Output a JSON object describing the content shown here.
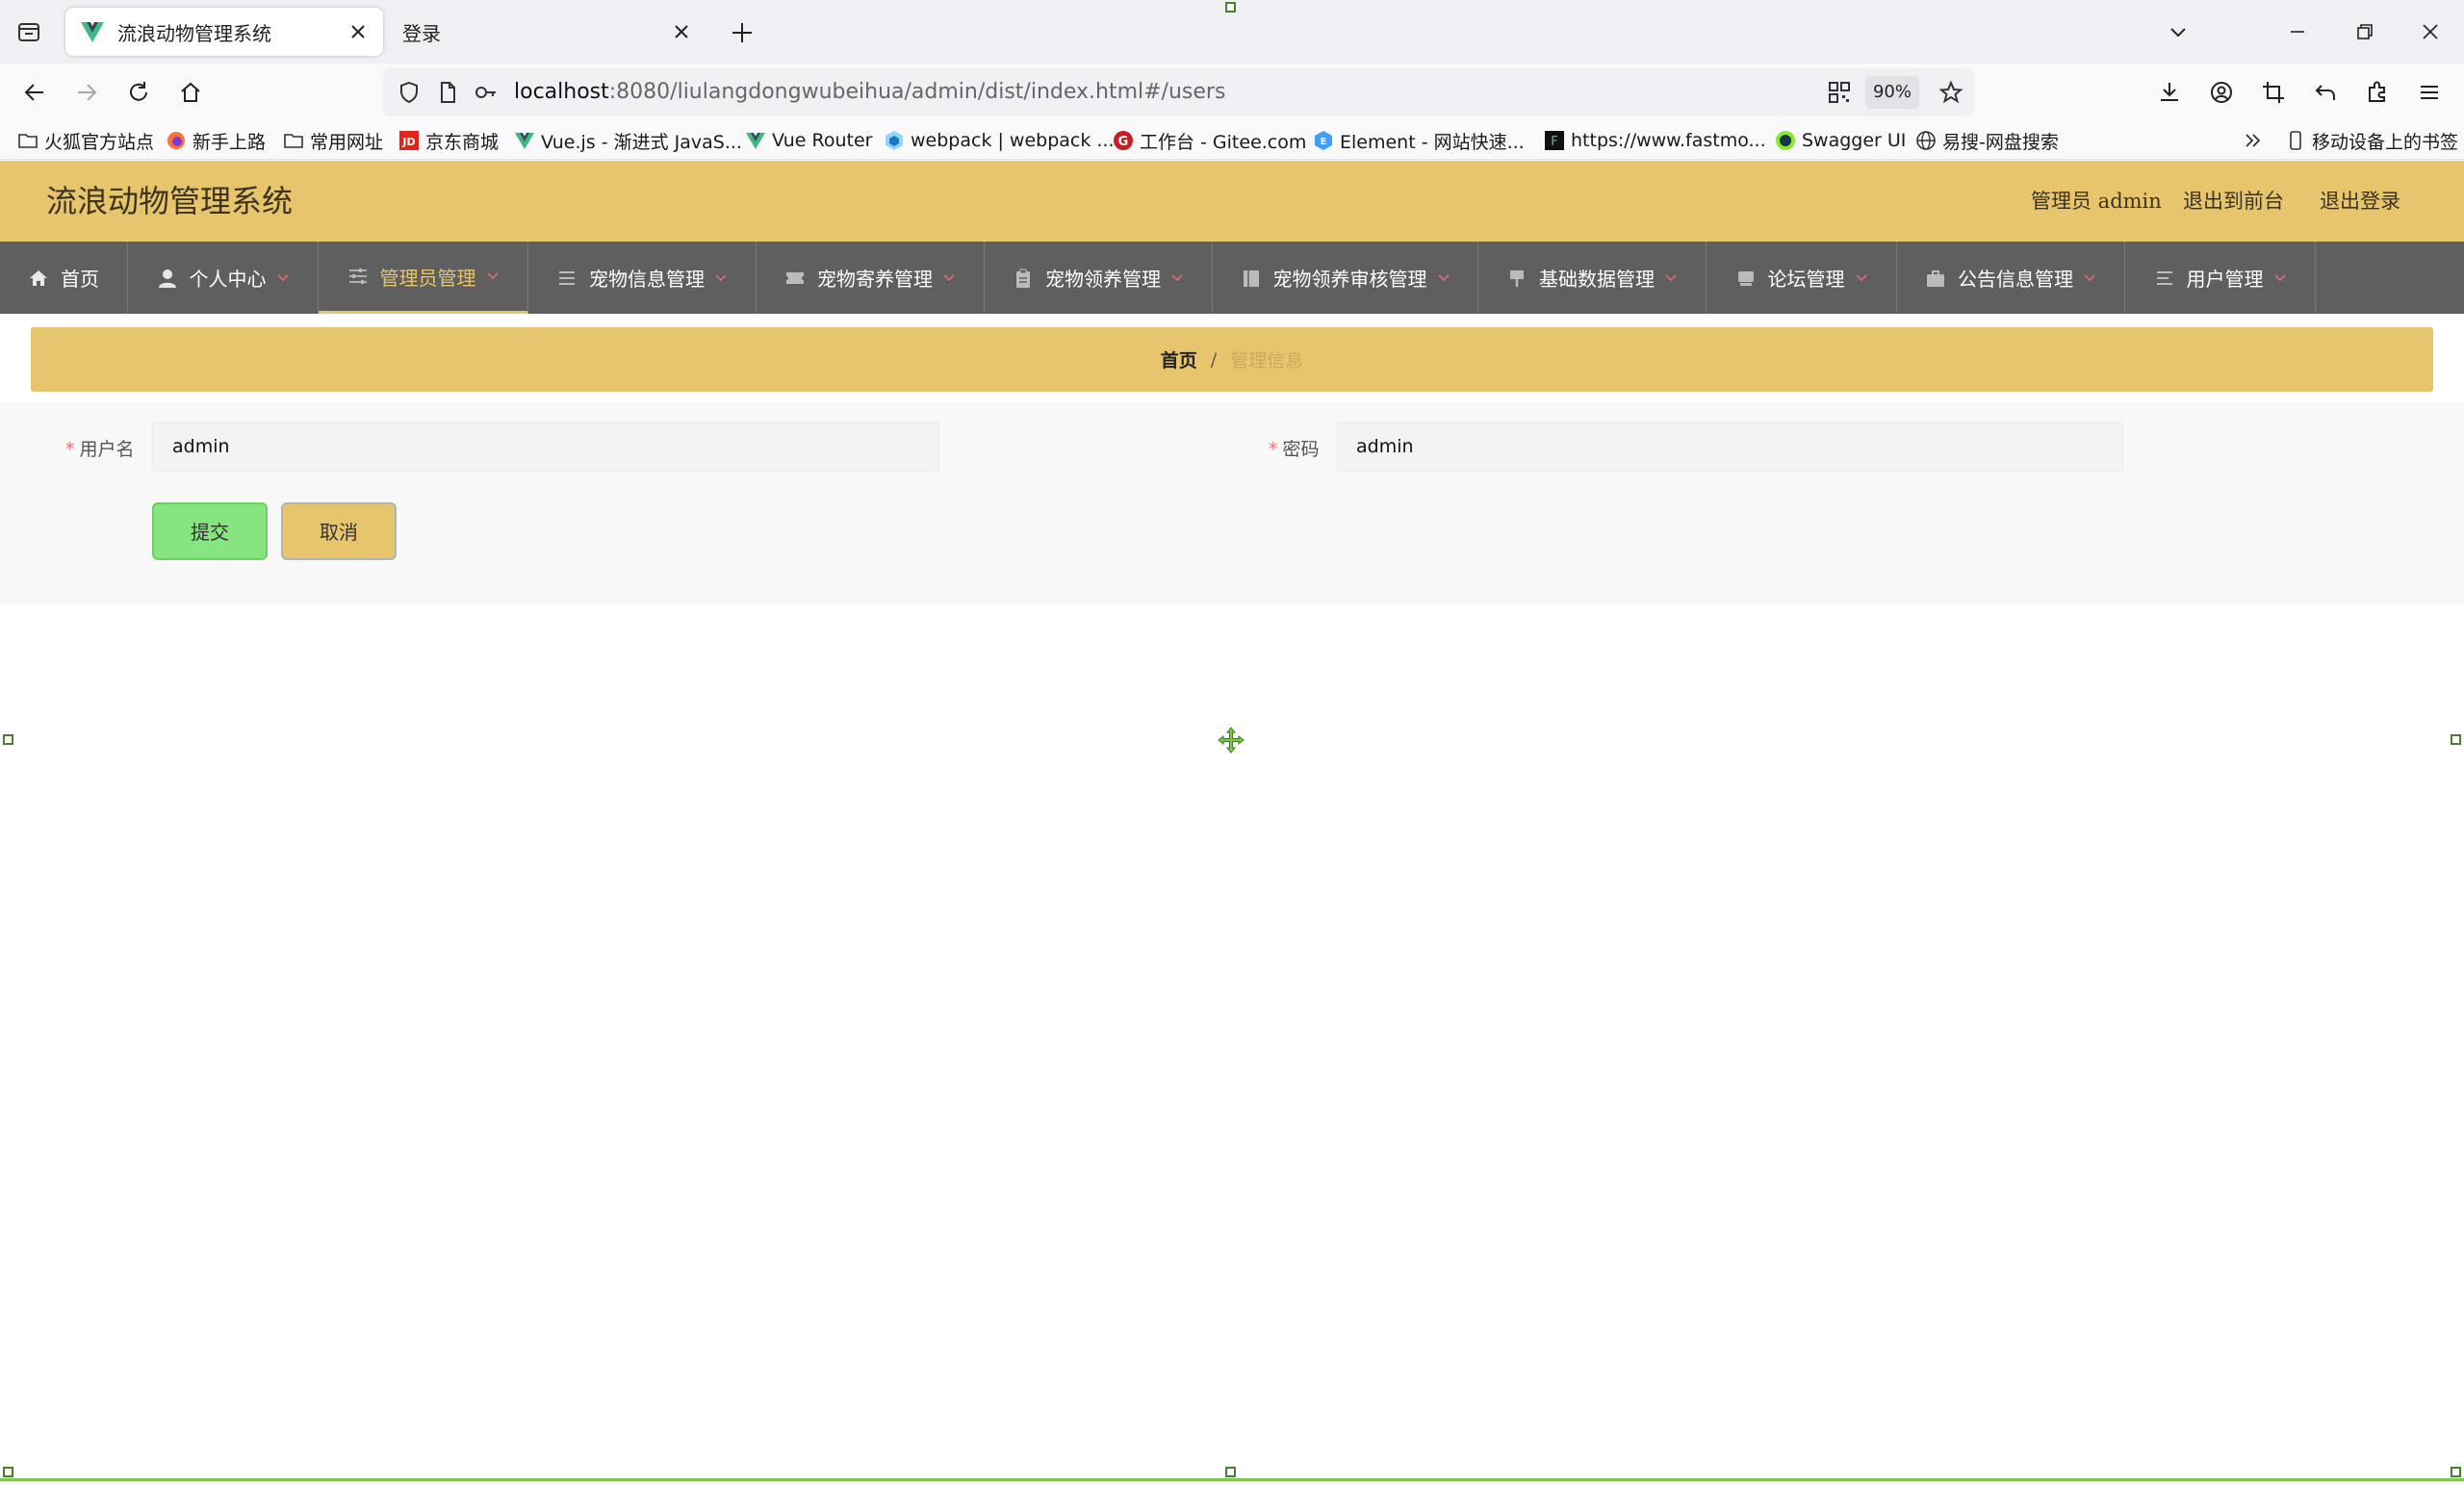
{
  "browser": {
    "tabs": [
      {
        "title": "流浪动物管理系统",
        "active": true
      },
      {
        "title": "登录",
        "active": false
      }
    ],
    "url": {
      "host": "localhost",
      "rest": ":8080/liulangdongwubeihua/admin/dist/index.html#/users"
    },
    "zoom": "90%",
    "bookmarks": [
      {
        "label": "火狐官方站点",
        "icon": "folder-icon"
      },
      {
        "label": "新手上路",
        "icon": "firefox-icon"
      },
      {
        "label": "常用网址",
        "icon": "folder-icon"
      },
      {
        "label": "京东商城",
        "icon": "jd-icon"
      },
      {
        "label": "Vue.js - 渐进式 JavaS...",
        "icon": "vue-icon"
      },
      {
        "label": "Vue Router",
        "icon": "vue-icon"
      },
      {
        "label": "webpack | webpack ...",
        "icon": "webpack-icon"
      },
      {
        "label": "工作台 - Gitee.com",
        "icon": "gitee-icon"
      },
      {
        "label": "Element - 网站快速...",
        "icon": "element-icon"
      },
      {
        "label": "https://www.fastmo...",
        "icon": "fastmock-icon"
      },
      {
        "label": "Swagger UI",
        "icon": "swagger-icon"
      },
      {
        "label": "易搜-网盘搜索",
        "icon": "globe-icon"
      }
    ],
    "mobile_bookmarks": "移动设备上的书签"
  },
  "app": {
    "title": "流浪动物管理系统",
    "header_links": {
      "admin": "管理员 admin",
      "front": "退出到前台",
      "logout": "退出登录"
    },
    "menu": [
      {
        "label": "首页",
        "icon": "home-icon",
        "dropdown": false
      },
      {
        "label": "个人中心",
        "icon": "user-icon",
        "dropdown": true
      },
      {
        "label": "管理员管理",
        "icon": "sliders-icon",
        "dropdown": true,
        "active": true
      },
      {
        "label": "宠物信息管理",
        "icon": "list-icon",
        "dropdown": true
      },
      {
        "label": "宠物寄养管理",
        "icon": "ticket-icon",
        "dropdown": true
      },
      {
        "label": "宠物领养管理",
        "icon": "clipboard-icon",
        "dropdown": true
      },
      {
        "label": "宠物领养审核管理",
        "icon": "book-icon",
        "dropdown": true
      },
      {
        "label": "基础数据管理",
        "icon": "pin-icon",
        "dropdown": true
      },
      {
        "label": "论坛管理",
        "icon": "forum-icon",
        "dropdown": true
      },
      {
        "label": "公告信息管理",
        "icon": "briefcase-icon",
        "dropdown": true
      },
      {
        "label": "用户管理",
        "icon": "menu-lines-icon",
        "dropdown": true
      }
    ],
    "breadcrumb": {
      "home": "首页",
      "separator": "/",
      "current": "管理信息"
    },
    "form": {
      "username_label": "用户名",
      "username_value": "admin",
      "password_label": "密码",
      "password_value": "admin",
      "required_mark": "*",
      "submit": "提交",
      "cancel": "取消"
    }
  },
  "colors": {
    "accent": "#e7c56c",
    "nav_bg": "#5f5f5f",
    "submit_bg": "#86e57e",
    "required": "#f56c6c"
  }
}
